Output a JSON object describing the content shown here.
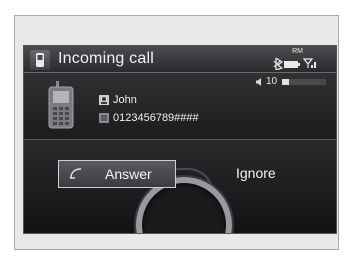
{
  "header": {
    "title": "Incoming call",
    "tab_icon": "phone-tab-icon",
    "status": {
      "roaming_label": "RM",
      "bluetooth_icon": "bluetooth-icon",
      "battery_icon": "battery-icon",
      "signal_icon": "signal-icon"
    }
  },
  "volume": {
    "icon": "speaker-icon",
    "level_label": "10",
    "level_fraction": 0.15
  },
  "caller": {
    "phone_icon": "mobile-phone-icon",
    "name": "John",
    "name_icon": "contact-icon",
    "number": "0123456789####",
    "number_icon": "phonebook-icon"
  },
  "actions": {
    "answer_label": "Answer",
    "answer_icon": "pickup-icon",
    "ignore_label": "Ignore"
  },
  "colors": {
    "screen_bg": "#1e1e20",
    "text": "#f0f0f0",
    "frame_bg": "#e9e9e9"
  }
}
